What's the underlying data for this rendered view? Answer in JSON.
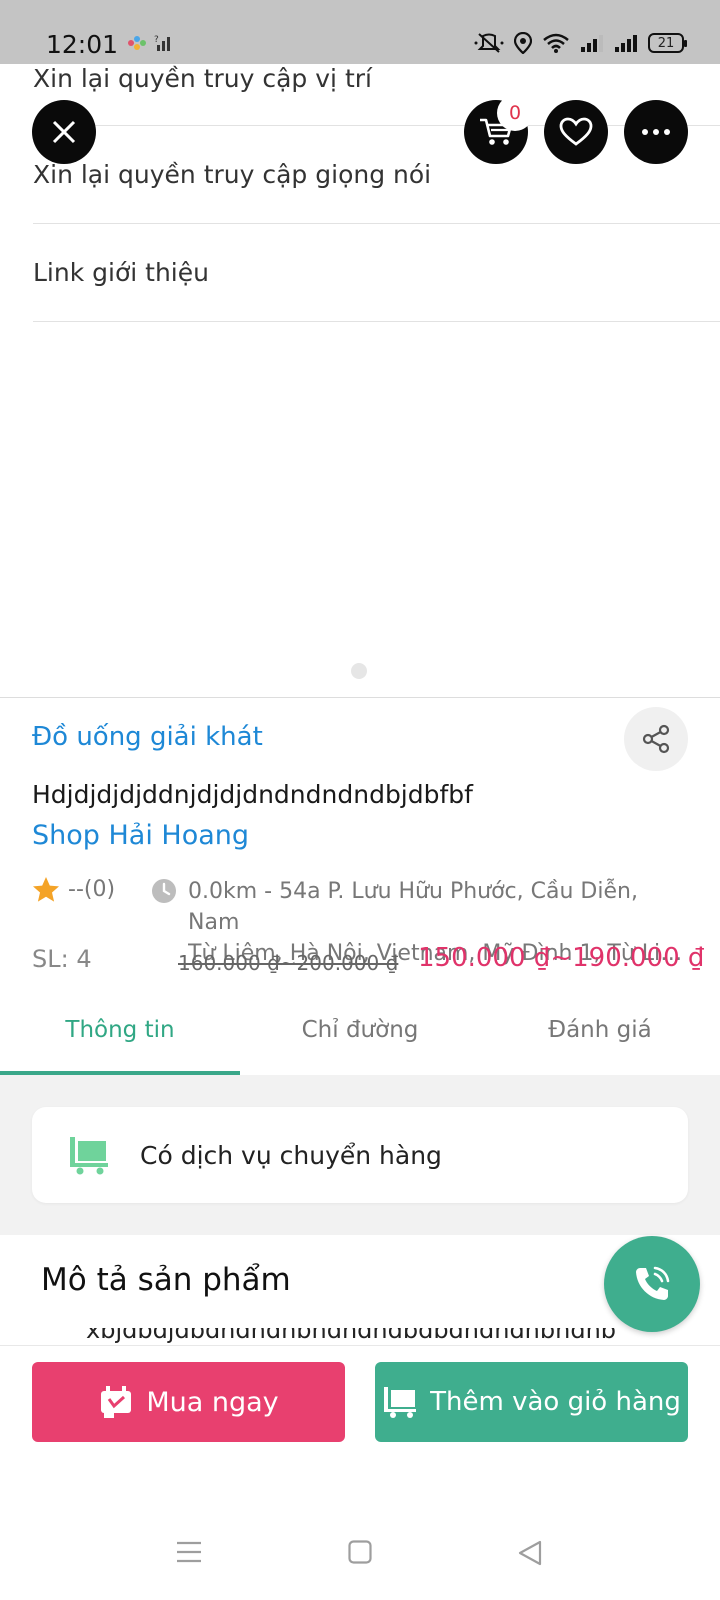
{
  "status_bar": {
    "time": "12:01",
    "battery": "21"
  },
  "background_menu": {
    "items": [
      "Xin lại quyền truy cập vị trí",
      "Xin lại quyền truy cập giọng nói",
      "Link giới thiệu"
    ]
  },
  "top_actions": {
    "cart_count": "0"
  },
  "product": {
    "category": "Đồ uống giải khát",
    "name": "Hdjdjdjdjddnjdjdjdndndndndbjdbfbf",
    "shop": "Shop Hải Hoang",
    "rating": "--(0)",
    "address_line1": "0.0km - 54a P. Lưu Hữu Phước, Cầu Diễn, Nam",
    "address_line2": "Từ Liêm, Hà Nội, Vietnam, Mỹ Đình 1, Từ Liêm, Hà Nội",
    "quantity": "SL: 4",
    "old_price": "160.000 ₫~200.000 ₫",
    "new_price": "150.000 ₫~190.000 ₫"
  },
  "tabs": [
    {
      "label": "Thông tin",
      "active": true
    },
    {
      "label": "Chỉ đường",
      "active": false
    },
    {
      "label": "Đánh giá",
      "active": false
    }
  ],
  "shipping": {
    "label": "Có dịch vụ chuyển hàng"
  },
  "description": {
    "title": "Mô tả sản phẩm",
    "text": "xbjdbdjdbdhdhdhbhdhdhdbdbdhdhdhbhdhb"
  },
  "buttons": {
    "buy_now": "Mua ngay",
    "add_to_cart": "Thêm vào giỏ hàng"
  },
  "colors": {
    "accent_green": "#3fae8e",
    "buy_pink": "#e8406f",
    "link_blue": "#1e88d6",
    "price_pink": "#e0336a"
  }
}
